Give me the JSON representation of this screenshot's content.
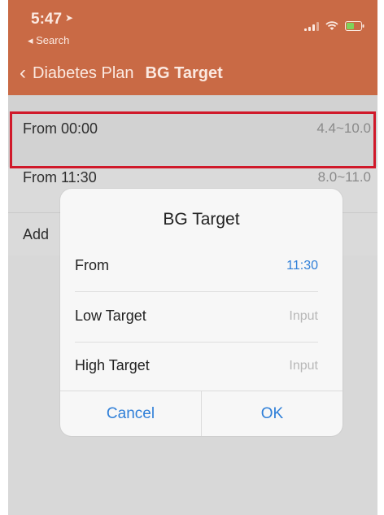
{
  "status_bar": {
    "time": "5:47",
    "back_app": "◂ Search"
  },
  "nav": {
    "back_label": "Diabetes Plan",
    "title": "BG Target"
  },
  "list": {
    "rows": [
      {
        "label": "From 00:00",
        "value": "4.4~10.0"
      },
      {
        "label": "From 11:30",
        "value": "8.0~11.0"
      }
    ],
    "add_label": "Add"
  },
  "dialog": {
    "title": "BG Target",
    "from_label": "From",
    "from_value": "11:30",
    "low_label": "Low Target",
    "low_placeholder": "Input",
    "high_label": "High Target",
    "high_placeholder": "Input",
    "cancel_label": "Cancel",
    "ok_label": "OK"
  },
  "colors": {
    "header": "#c96a45",
    "accent": "#2f7fd8",
    "highlight": "#d0192a"
  },
  "icons": [
    "location-arrow-icon",
    "signal-icon",
    "wifi-icon",
    "battery-icon",
    "chevron-left-icon"
  ]
}
